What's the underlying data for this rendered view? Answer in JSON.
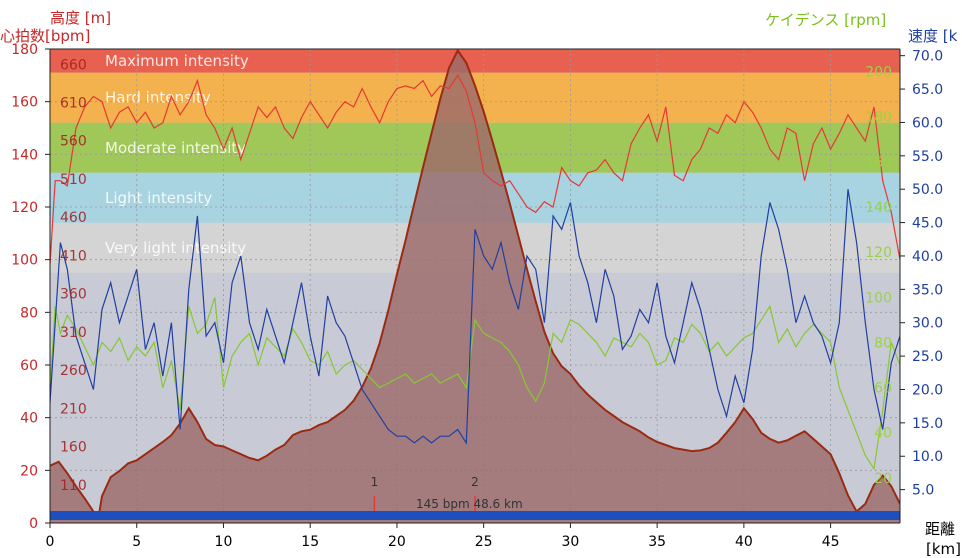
{
  "axis_titles": {
    "heart_rate": "心拍数[bpm]",
    "altitude": "高度 [m]",
    "cadence": "ケイデンス [rpm]",
    "speed": "速度 [k",
    "distance": "距離",
    "distance_unit": "[km]"
  },
  "colors": {
    "zone_max": "#e8604f",
    "zone_hard": "#f3b24e",
    "zone_moderate": "#a0c858",
    "zone_light": "#a8d3e0",
    "zone_very_light": "#d4d4d4",
    "below_zones": "#c8cad6",
    "hr_line": "#e53935",
    "altitude_fill": "#9c6a6a",
    "altitude_line": "#9a2a12",
    "speed_line": "#213fa0",
    "cadence_line": "#88c832",
    "baseline_bar": "#1f4fbf"
  },
  "chart_data": {
    "type": "line",
    "xlabel": "距離 [km]",
    "x_ticks": [
      "0",
      "5",
      "10",
      "15",
      "20",
      "25",
      "30",
      "35",
      "40",
      "45"
    ],
    "xlim": [
      0,
      49
    ],
    "hr_axis": {
      "label": "心拍数[bpm]",
      "ticks": [
        "0",
        "20",
        "40",
        "60",
        "80",
        "100",
        "120",
        "140",
        "160",
        "180"
      ],
      "range": [
        0,
        180
      ]
    },
    "altitude_axis": {
      "label": "高度 [m]",
      "ticks": [
        "110",
        "160",
        "210",
        "260",
        "310",
        "360",
        "410",
        "460",
        "510",
        "560",
        "610",
        "660"
      ],
      "range": [
        60,
        680
      ]
    },
    "cadence_axis": {
      "label": "ケイデンス [rpm]",
      "ticks": [
        "20",
        "40",
        "60",
        "80",
        "100",
        "120",
        "140",
        "160",
        "180",
        "200"
      ],
      "range": [
        0,
        210
      ]
    },
    "speed_axis": {
      "label": "速度 [k",
      "ticks": [
        "5.0",
        "10.0",
        "15.0",
        "20.0",
        "25.0",
        "30.0",
        "35.0",
        "40.0",
        "45.0",
        "50.0",
        "55.0",
        "60.0",
        "65.0",
        "70.0"
      ],
      "range": [
        0,
        71
      ]
    },
    "zones": [
      {
        "name": "Maximum intensity",
        "from": 171,
        "to": 180
      },
      {
        "name": "Hard intensity",
        "from": 152,
        "to": 171
      },
      {
        "name": "Moderate intensity",
        "from": 133,
        "to": 152
      },
      {
        "name": "Light intensity",
        "from": 114,
        "to": 133
      },
      {
        "name": "Very light intensity",
        "from": 95,
        "to": 114
      }
    ],
    "markers": [
      {
        "label": "1",
        "x": 18.7
      },
      {
        "label": "2",
        "x": 24.5
      }
    ],
    "cursor_readout": "145 bpm  48.6 km",
    "series": [
      {
        "key": "altitude",
        "axis": "altitude",
        "x": [
          0,
          0.5,
          1,
          1.5,
          2,
          2.5,
          2.8,
          3,
          3.5,
          4,
          4.5,
          5,
          5.5,
          6,
          6.5,
          7,
          7.5,
          8,
          8.5,
          9,
          9.5,
          10,
          10.5,
          11,
          11.5,
          12,
          12.5,
          13,
          13.5,
          14,
          14.5,
          15,
          15.5,
          16,
          16.5,
          17,
          17.5,
          18,
          18.5,
          19,
          19.5,
          20,
          20.5,
          21,
          21.5,
          22,
          22.5,
          23,
          23.5,
          24,
          24.5,
          25,
          25.5,
          26,
          26.5,
          27,
          27.5,
          28,
          28.5,
          29,
          29.5,
          30,
          30.5,
          31,
          31.5,
          32,
          32.5,
          33,
          33.5,
          34,
          34.5,
          35,
          35.5,
          36,
          36.5,
          37,
          37.5,
          38,
          38.5,
          39,
          39.5,
          40,
          40.5,
          41,
          41.5,
          42,
          42.5,
          43,
          43.5,
          44,
          44.5,
          45,
          45.5,
          46,
          46.5,
          47,
          47.5,
          48,
          48.5,
          49
        ],
        "values": [
          135,
          140,
          125,
          108,
          92,
          75,
          68,
          95,
          120,
          128,
          138,
          142,
          150,
          158,
          166,
          175,
          190,
          210,
          192,
          170,
          162,
          160,
          155,
          150,
          145,
          142,
          148,
          156,
          162,
          175,
          180,
          182,
          188,
          192,
          200,
          208,
          220,
          238,
          262,
          295,
          338,
          385,
          430,
          478,
          525,
          570,
          615,
          655,
          678,
          662,
          632,
          598,
          560,
          520,
          478,
          435,
          392,
          350,
          310,
          282,
          265,
          255,
          240,
          228,
          218,
          208,
          200,
          192,
          186,
          180,
          172,
          166,
          162,
          158,
          156,
          154,
          155,
          158,
          165,
          178,
          192,
          210,
          196,
          178,
          170,
          165,
          168,
          174,
          180,
          170,
          160,
          150,
          125,
          96,
          75,
          85,
          110,
          122,
          108,
          85
        ]
      },
      {
        "key": "heart_rate",
        "axis": "hr",
        "x": [
          0,
          0.3,
          0.6,
          1,
          1.5,
          2,
          2.5,
          3,
          3.5,
          4,
          4.5,
          5,
          5.5,
          6,
          6.5,
          7,
          7.5,
          8,
          8.5,
          9,
          9.5,
          10,
          10.5,
          11,
          11.5,
          12,
          12.5,
          13,
          13.5,
          14,
          14.5,
          15,
          15.5,
          16,
          16.5,
          17,
          17.5,
          18,
          18.5,
          19,
          19.5,
          20,
          20.5,
          21,
          21.5,
          22,
          22.5,
          23,
          23.5,
          24,
          24.5,
          25,
          25.5,
          26,
          26.5,
          27,
          27.5,
          28,
          28.5,
          29,
          29.5,
          30,
          30.5,
          31,
          31.5,
          32,
          32.5,
          33,
          33.5,
          34,
          34.5,
          35,
          35.5,
          36,
          36.5,
          37,
          37.5,
          38,
          38.5,
          39,
          39.5,
          40,
          40.5,
          41,
          41.5,
          42,
          42.5,
          43,
          43.5,
          44,
          44.5,
          45,
          45.5,
          46,
          46.5,
          47,
          47.5,
          48,
          48.5,
          49
        ],
        "values": [
          98,
          130,
          130,
          128,
          150,
          158,
          162,
          160,
          150,
          156,
          158,
          152,
          156,
          150,
          152,
          162,
          155,
          160,
          168,
          155,
          150,
          142,
          150,
          138,
          148,
          158,
          154,
          158,
          150,
          146,
          154,
          160,
          155,
          150,
          156,
          160,
          158,
          165,
          158,
          152,
          160,
          165,
          166,
          165,
          168,
          162,
          166,
          165,
          170,
          164,
          152,
          133,
          130,
          128,
          130,
          125,
          120,
          118,
          122,
          120,
          135,
          130,
          128,
          133,
          134,
          138,
          133,
          130,
          144,
          150,
          155,
          145,
          158,
          132,
          130,
          138,
          142,
          150,
          148,
          155,
          152,
          160,
          156,
          150,
          142,
          138,
          150,
          148,
          130,
          144,
          150,
          142,
          148,
          155,
          150,
          145,
          158,
          130,
          118,
          100
        ]
      },
      {
        "key": "speed",
        "axis": "speed",
        "x": [
          0,
          0.3,
          0.6,
          1,
          1.5,
          2,
          2.5,
          3,
          3.5,
          4,
          4.5,
          5,
          5.5,
          6,
          6.5,
          7,
          7.5,
          8,
          8.5,
          9,
          9.5,
          10,
          10.5,
          11,
          11.5,
          12,
          12.5,
          13,
          13.5,
          14,
          14.5,
          15,
          15.5,
          16,
          16.5,
          17,
          17.5,
          18,
          18.5,
          19,
          19.5,
          20,
          20.5,
          21,
          21.5,
          22,
          22.5,
          23,
          23.5,
          24,
          24.5,
          25,
          25.5,
          26,
          26.5,
          27,
          27.5,
          28,
          28.5,
          29,
          29.5,
          30,
          30.5,
          31,
          31.5,
          32,
          32.5,
          33,
          33.5,
          34,
          34.5,
          35,
          35.5,
          36,
          36.5,
          37,
          37.5,
          38,
          38.5,
          39,
          39.5,
          40,
          40.5,
          41,
          41.5,
          42,
          42.5,
          43,
          43.5,
          44,
          44.5,
          45,
          45.5,
          46,
          46.5,
          47,
          47.5,
          48,
          48.5,
          49
        ],
        "values": [
          18,
          30,
          42,
          38,
          28,
          24,
          20,
          32,
          36,
          30,
          34,
          38,
          26,
          30,
          22,
          30,
          14,
          35,
          46,
          28,
          30,
          24,
          36,
          40,
          30,
          26,
          32,
          28,
          24,
          30,
          36,
          28,
          22,
          34,
          30,
          28,
          24,
          20,
          18,
          16,
          14,
          13,
          13,
          12,
          13,
          12,
          13,
          13,
          14,
          12,
          44,
          40,
          38,
          42,
          36,
          32,
          40,
          38,
          30,
          46,
          44,
          48,
          40,
          36,
          30,
          38,
          34,
          26,
          28,
          32,
          30,
          36,
          28,
          24,
          30,
          36,
          32,
          26,
          20,
          16,
          22,
          18,
          26,
          40,
          48,
          44,
          38,
          30,
          34,
          30,
          28,
          24,
          30,
          50,
          42,
          30,
          20,
          14,
          24,
          28
        ]
      },
      {
        "key": "cadence",
        "axis": "cadence",
        "x": [
          0,
          0.3,
          0.6,
          1,
          1.5,
          2,
          2.5,
          3,
          3.5,
          4,
          4.5,
          5,
          5.5,
          6,
          6.5,
          7,
          7.5,
          8,
          8.5,
          9,
          9.5,
          10,
          10.5,
          11,
          11.5,
          12,
          12.5,
          13,
          13.5,
          14,
          14.5,
          15,
          15.5,
          16,
          16.5,
          17,
          17.5,
          18,
          18.5,
          19,
          19.5,
          20,
          20.5,
          21,
          21.5,
          22,
          22.5,
          23,
          23.5,
          24,
          24.5,
          25,
          25.5,
          26,
          26.5,
          27,
          27.5,
          28,
          28.5,
          29,
          29.5,
          30,
          30.5,
          31,
          31.5,
          32,
          32.5,
          33,
          33.5,
          34,
          34.5,
          35,
          35.5,
          36,
          36.5,
          37,
          37.5,
          38,
          38.5,
          39,
          39.5,
          40,
          40.5,
          41,
          41.5,
          42,
          42.5,
          43,
          43.5,
          44,
          44.5,
          45,
          45.5,
          46,
          46.5,
          47,
          47.5,
          48,
          48.5,
          49
        ],
        "values": [
          60,
          96,
          84,
          92,
          86,
          78,
          70,
          80,
          76,
          82,
          72,
          78,
          74,
          80,
          60,
          72,
          50,
          96,
          84,
          88,
          100,
          60,
          74,
          80,
          84,
          70,
          82,
          78,
          74,
          86,
          80,
          72,
          70,
          76,
          66,
          70,
          72,
          68,
          64,
          60,
          62,
          64,
          66,
          62,
          64,
          66,
          62,
          64,
          66,
          60,
          90,
          84,
          82,
          80,
          76,
          70,
          60,
          54,
          62,
          84,
          80,
          90,
          88,
          84,
          80,
          74,
          82,
          80,
          78,
          84,
          80,
          70,
          72,
          82,
          80,
          88,
          84,
          76,
          80,
          74,
          78,
          82,
          84,
          90,
          96,
          80,
          86,
          78,
          84,
          88,
          84,
          80,
          60,
          50,
          40,
          30,
          24,
          50,
          80,
          70
        ]
      }
    ]
  }
}
